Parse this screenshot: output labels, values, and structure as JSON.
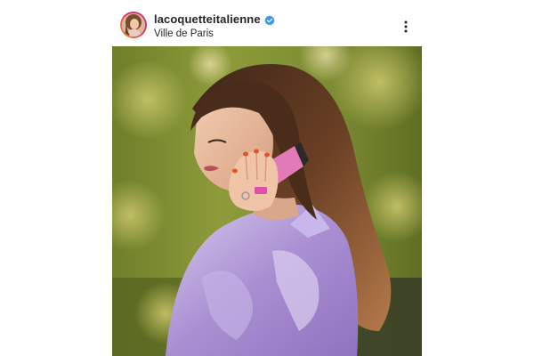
{
  "post": {
    "username": "lacoquetteitalienne",
    "location": "Ville de Paris",
    "verified": true
  },
  "icons": {
    "verified": "verified-badge-icon",
    "more": "more-options-icon",
    "avatar": "profile-avatar"
  },
  "colors": {
    "verified_blue": "#3897f0",
    "text_primary": "#262626",
    "story_ring": [
      "#f9a03f",
      "#e1306c",
      "#c13584"
    ]
  }
}
